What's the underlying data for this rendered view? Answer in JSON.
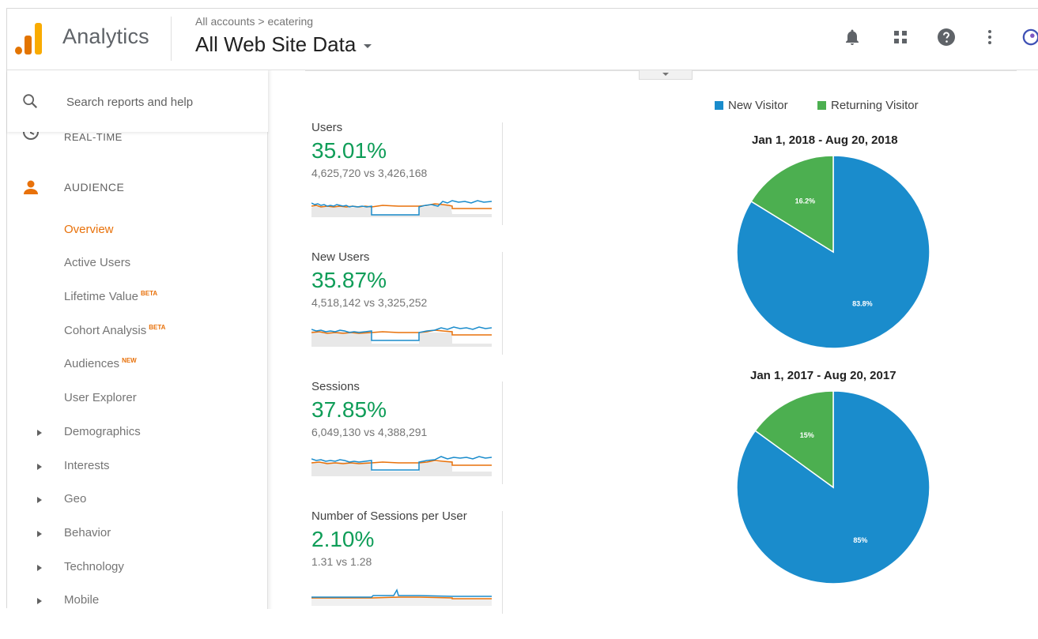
{
  "header": {
    "app_name": "Analytics",
    "breadcrumb": "All accounts > ecatering",
    "property": "All Web Site Data"
  },
  "sidebar": {
    "search_placeholder": "Search reports and help",
    "realtime": "REAL-TIME",
    "audience": "AUDIENCE",
    "items": [
      {
        "label": "Overview",
        "active": true
      },
      {
        "label": "Active Users"
      },
      {
        "label": "Lifetime Value",
        "badge": "BETA"
      },
      {
        "label": "Cohort Analysis",
        "badge": "BETA"
      },
      {
        "label": "Audiences",
        "badge": "NEW"
      },
      {
        "label": "User Explorer"
      },
      {
        "label": "Demographics",
        "expandable": true
      },
      {
        "label": "Interests",
        "expandable": true
      },
      {
        "label": "Geo",
        "expandable": true
      },
      {
        "label": "Behavior",
        "expandable": true
      },
      {
        "label": "Technology",
        "expandable": true
      },
      {
        "label": "Mobile",
        "expandable": true
      }
    ]
  },
  "metrics": [
    {
      "label": "Users",
      "pct": "35.01%",
      "compare": "4,625,720 vs 3,426,168"
    },
    {
      "label": "New Users",
      "pct": "35.87%",
      "compare": "4,518,142 vs 3,325,252"
    },
    {
      "label": "Sessions",
      "pct": "37.85%",
      "compare": "6,049,130 vs 4,388,291"
    },
    {
      "label": "Number of Sessions per User",
      "pct": "2.10%",
      "compare": "1.31 vs 1.28"
    }
  ],
  "colors": {
    "new_visitor": "#1a8ccc",
    "returning_visitor": "#4caf50",
    "positive": "#0f9d58",
    "accent_orange": "#e8710a"
  },
  "chart_data": [
    {
      "type": "pie",
      "title": "Jan 1, 2018 - Aug 20, 2018",
      "legend": "top",
      "series": [
        {
          "name": "New Visitor",
          "value": 83.8,
          "label": "83.8%"
        },
        {
          "name": "Returning Visitor",
          "value": 16.2,
          "label": "16.2%"
        }
      ]
    },
    {
      "type": "pie",
      "title": "Jan 1, 2017 - Aug 20, 2017",
      "legend": "top",
      "series": [
        {
          "name": "New Visitor",
          "value": 85,
          "label": "85%"
        },
        {
          "name": "Returning Visitor",
          "value": 15,
          "label": "15%"
        }
      ]
    }
  ]
}
